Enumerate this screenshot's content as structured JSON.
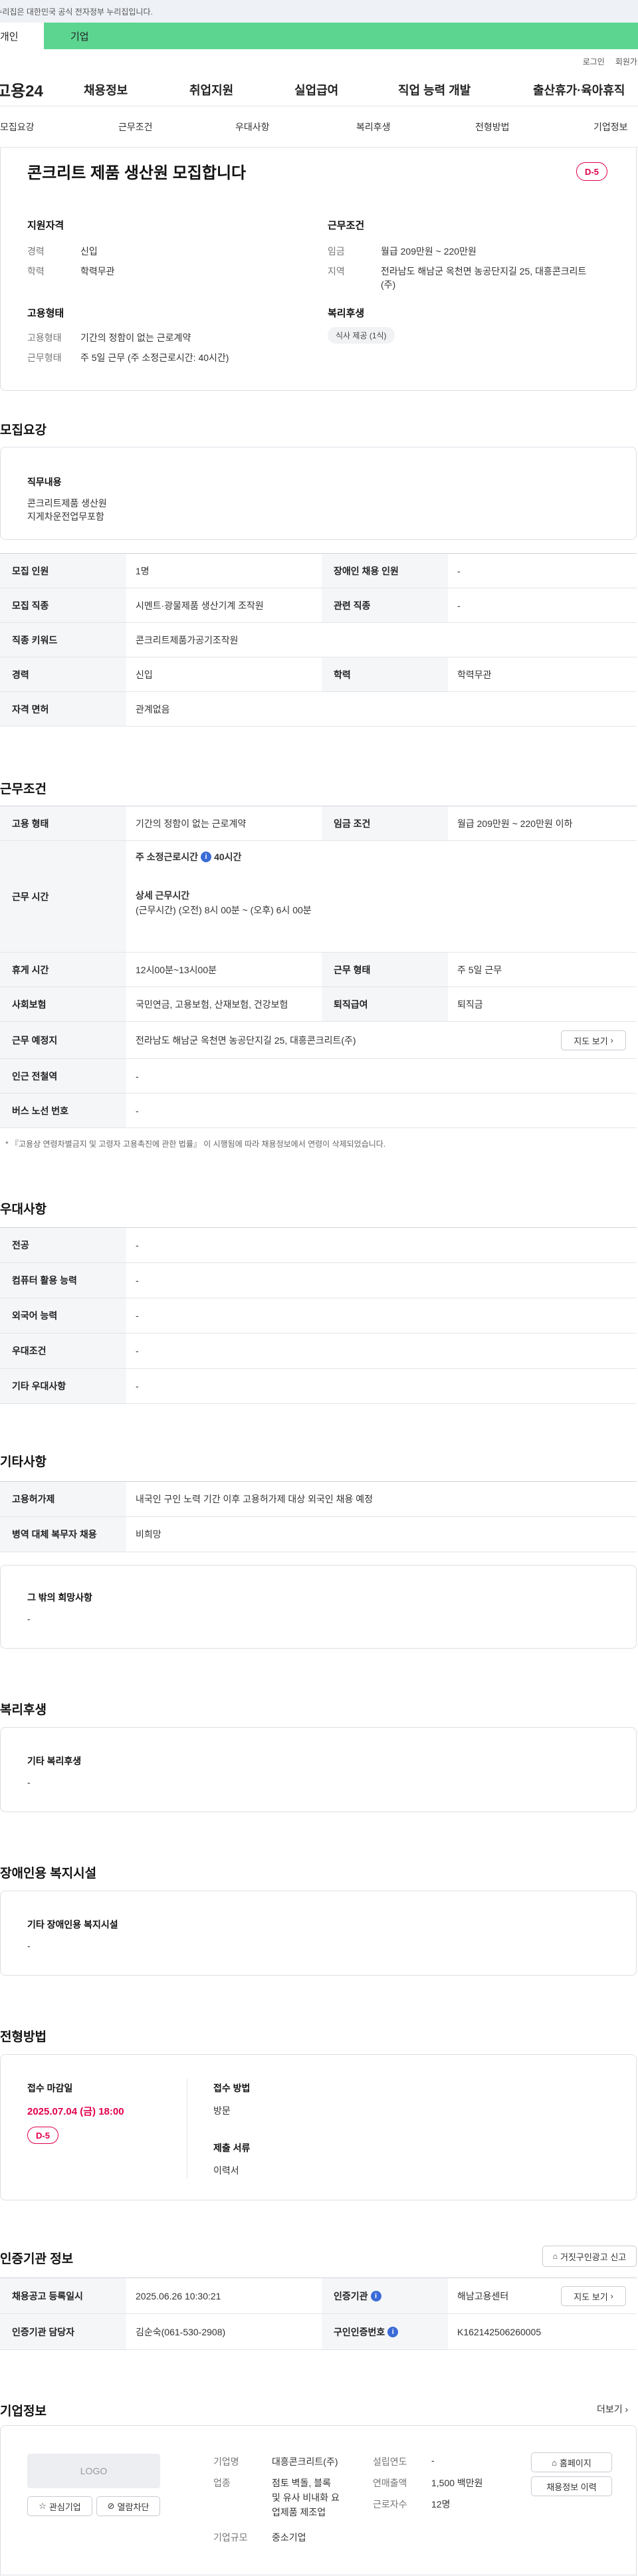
{
  "notice": "이 누리집은 대한민국 공식 전자정부 누리집입니다.",
  "top_tabs": [
    "개인",
    "기업"
  ],
  "top_links": {
    "login": "로그인",
    "join": "회원가입"
  },
  "gnb": {
    "logo": "고용24",
    "menu": [
      "채용정보",
      "취업지원",
      "실업급여",
      "직업 능력 개발",
      "출산휴가·육아휴직"
    ]
  },
  "subnav": [
    "모집요강",
    "근무조건",
    "우대사항",
    "복리후생",
    "전형방법",
    "기업정보"
  ],
  "summary": {
    "title": "콘크리트 제품 생산원 모집합니다",
    "dday": "D-5",
    "qual_title": "지원자격",
    "career_k": "경력",
    "career_v": "신입",
    "edu_k": "학력",
    "edu_v": "학력무관",
    "cond_title": "근무조건",
    "wage_k": "임금",
    "wage_v": "월급 209만원 ~ 220만원",
    "region_k": "지역",
    "region_v1": "전라남도 해남군 옥천면 농공단지길 25, 대흥콘크리트",
    "region_v2": "(주)",
    "emp_title": "고용형태",
    "emptype_k": "고용형태",
    "emptype_v": "기간의 정함이 없는 근로계약",
    "worktype_k": "근무형태",
    "worktype_v": "주 5일 근무 (주 소정근로시간: 40시간)",
    "welfare_title": "복리후생",
    "welfare_chip": "식사 제공 (1식)"
  },
  "recruit": {
    "title": "모집요강",
    "duty_title": "직무내용",
    "duty_line1": "콘크리트제품 생산원",
    "duty_line2": "지게차운전업무포함",
    "rows": {
      "count_k": "모집 인원",
      "count_v": "1명",
      "disabled_k": "장애인 채용 인원",
      "disabled_v": "-",
      "job_k": "모집 직종",
      "job_v": "시멘트·광물제품 생산기계 조작원",
      "related_k": "관련 직종",
      "related_v": "-",
      "keyword_k": "직종 키워드",
      "keyword_v": "콘크리트제품가공기조작원",
      "career_k": "경력",
      "career_v": "신입",
      "edu_k": "학력",
      "edu_v": "학력무관",
      "license_k": "자격 면허",
      "license_v": "관계없음"
    }
  },
  "work": {
    "title": "근무조건",
    "emp_k": "고용 형태",
    "emp_v": "기간의 정함이 없는 근로계약",
    "wage_k": "임금 조건",
    "wage_v": "월급 209만원 ~ 220만원 이하",
    "time_k": "근무 시간",
    "time_week_label": "주 소정근로시간",
    "time_week_v": "40시간",
    "time_detail_label": "상세 근무시간",
    "time_detail_v": "(근무시간) (오전) 8시 00분 ~ (오후) 6시 00분",
    "rest_k": "휴게 시간",
    "rest_v": "12시00분~13시00분",
    "worktype_k": "근무 형태",
    "worktype_v": "주 5일 근무",
    "insurance_k": "사회보험",
    "insurance_v": "국민연금, 고용보험, 산재보험, 건강보험",
    "severance_k": "퇴직급여",
    "severance_v": "퇴직금",
    "place_k": "근무 예정지",
    "place_v": "전라남도 해남군 옥천면 농공단지길 25, 대흥콘크리트(주)",
    "map_btn": "지도 보기",
    "subway_k": "인근 전철역",
    "subway_v": "-",
    "bus_k": "버스 노선 번호",
    "bus_v": "-",
    "footnote": "* 『고용상 연령차별금지 및 고령자 고용촉진에 관한 법률』 이 시행됨에 따라 채용정보에서 연령이 삭제되었습니다."
  },
  "pref": {
    "title": "우대사항",
    "major_k": "전공",
    "major_v": "-",
    "computer_k": "컴퓨터 활용 능력",
    "computer_v": "-",
    "lang_k": "외국어 능력",
    "lang_v": "-",
    "cond_k": "우대조건",
    "cond_v": "-",
    "etc_k": "기타 우대사항",
    "etc_v": "-"
  },
  "etc": {
    "title": "기타사항",
    "permit_k": "고용허가제",
    "permit_v": "내국인 구인 노력 기간 이후 고용허가제 대상 외국인 채용 예정",
    "military_k": "병역 대체 복무자 채용",
    "military_v": "비희망",
    "other_title": "그 밖의 희망사항",
    "other_v": "-"
  },
  "welfare": {
    "title": "복리후생",
    "box_title": "기타 복리후생",
    "box_v": "-"
  },
  "disab": {
    "title": "장애인용 복지시설",
    "box_title": "기타 장애인용 복지시설",
    "box_v": "-"
  },
  "selection": {
    "title": "전형방법",
    "deadline_k": "접수 마감일",
    "deadline_v": "2025.07.04 (금) 18:00",
    "dday": "D-5",
    "method_k": "접수 방법",
    "method_v": "방문",
    "docs_k": "제출 서류",
    "docs_v": "이력서"
  },
  "cert": {
    "title": "인증기관 정보",
    "report_btn": "거짓구인광고 신고",
    "regdate_k": "채용공고 등록일시",
    "regdate_v": "2025.06.26 10:30:21",
    "agency_k": "인증기관",
    "agency_v": "해남고용센터",
    "map_btn": "지도 보기",
    "manager_k": "인증기관 담당자",
    "manager_v": "김순숙(061-530-2908)",
    "certno_k": "구인인증번호",
    "certno_v": "K162142506260005"
  },
  "company": {
    "title": "기업정보",
    "more": "더보기",
    "logo": "LOGO",
    "interest_btn": "관심기업",
    "block_btn": "열람차단",
    "name_k": "기업명",
    "name_v": "대흥콘크리트(주)",
    "industry_k": "업종",
    "industry_v1": "점토 벽돌, 블록",
    "industry_v2": "및 유사 비내화 요",
    "industry_v3": "업제품 제조업",
    "size_k": "기업규모",
    "size_v": "중소기업",
    "founded_k": "설립연도",
    "founded_v": "-",
    "sales_k": "연매출액",
    "sales_v": "1,500 백만원",
    "staff_k": "근로자수",
    "staff_v": "12명",
    "home_btn": "홈페이지",
    "history_btn": "채용정보 이력"
  },
  "colors": {
    "accent_green": "#5cd591",
    "dday_red": "#e0004d",
    "info_blue": "#3b6bd6"
  }
}
